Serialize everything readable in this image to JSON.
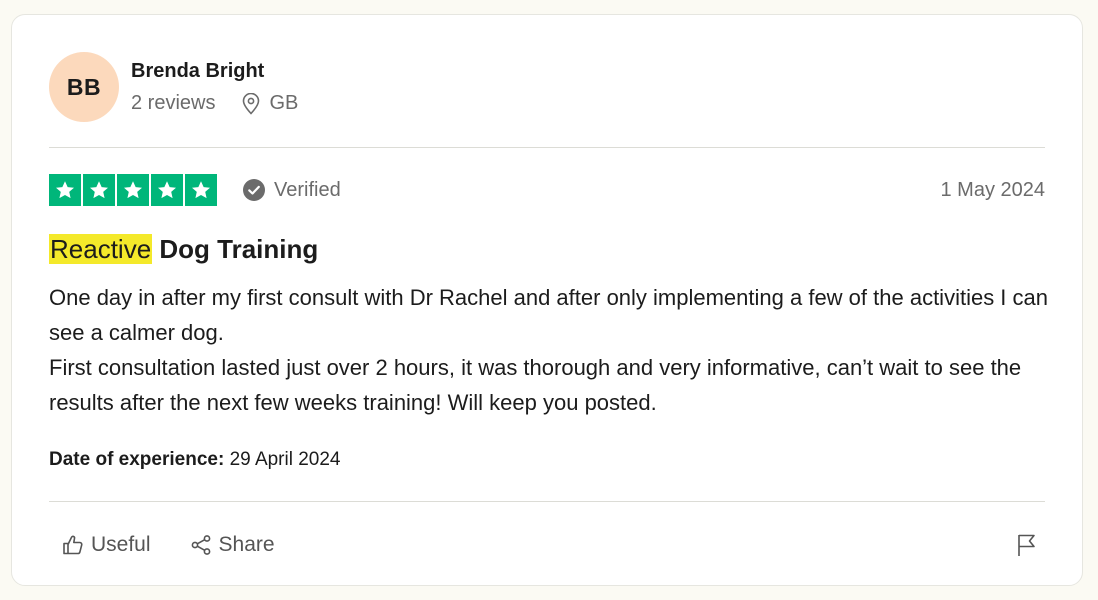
{
  "reviewer": {
    "initials": "BB",
    "name": "Brenda Bright",
    "reviews_count": "2 reviews",
    "country": "GB"
  },
  "review": {
    "stars": 5,
    "verified_label": "Verified",
    "date": "1 May 2024",
    "title_highlight": "Reactive",
    "title_rest": "Dog Training",
    "body_line1": "One day in after my first consult with Dr Rachel and after only implementing a few of the activities I can see a calmer dog.",
    "body_line2": "First consultation lasted just over 2 hours, it was thorough and very informative, can’t wait to see the results after the next few weeks training! Will keep you posted.",
    "experience_label": "Date of experience:",
    "experience_date": "29 April 2024"
  },
  "actions": {
    "useful_label": "Useful",
    "share_label": "Share"
  },
  "colors": {
    "star_green": "#00b67a",
    "avatar_bg": "#fcd9bc",
    "highlight": "#f4e92a"
  },
  "icons": [
    "location-pin-icon",
    "verified-check-icon",
    "star-icon",
    "thumbs-up-icon",
    "share-icon",
    "flag-icon"
  ]
}
